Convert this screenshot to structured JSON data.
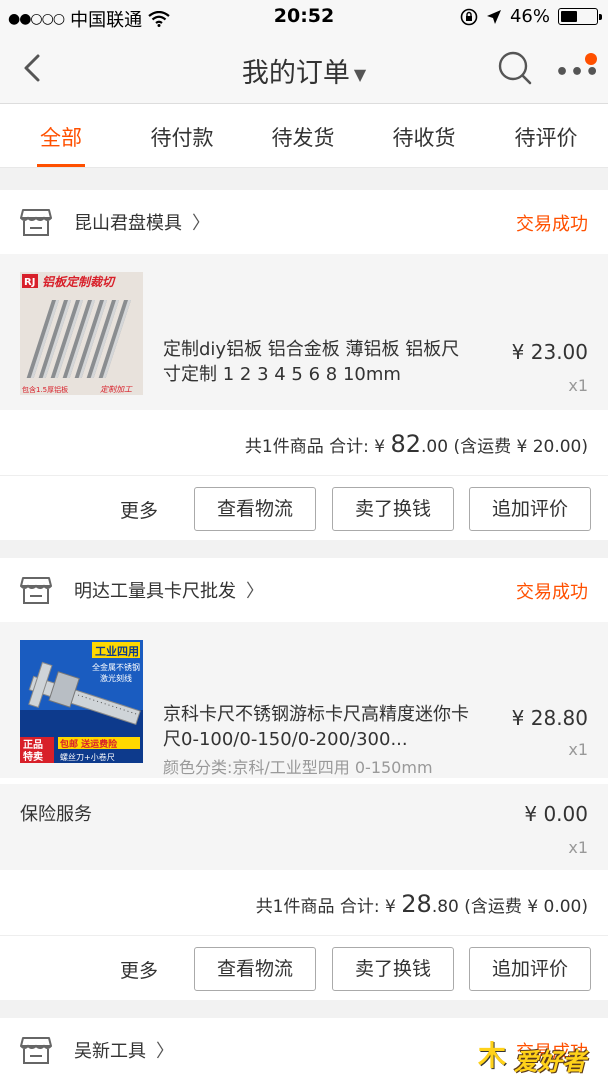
{
  "status_bar": {
    "carrier": "中国联通",
    "time": "20:52",
    "battery": "46%",
    "signal_dots": "●●○○○"
  },
  "nav": {
    "back_glyph": "〈",
    "title": "我的订单",
    "caret": "▼"
  },
  "tabs": [
    {
      "label": "全部",
      "active": true
    },
    {
      "label": "待付款"
    },
    {
      "label": "待发货"
    },
    {
      "label": "待收货"
    },
    {
      "label": "待评价"
    }
  ],
  "orders": [
    {
      "shop": "昆山君盘模具",
      "status": "交易成功",
      "item": {
        "title": "定制diy铝板 铝合金板 薄铝板 铝板尺寸定制 1 2 3 4 5 6 8 10mm",
        "price": "¥ 23.00",
        "qty": "x1",
        "thumb_text": "铝板定制裁切",
        "thumb_badge": "RJ",
        "thumb_note": "包含1.5厚铝板",
        "thumb_note2": "定制加工"
      },
      "summary": {
        "prefix": "共1件商品 合计: ¥ ",
        "big": "82",
        "small": ".00 (含运费 ¥ 20.00)"
      }
    },
    {
      "shop": "明达工量具卡尺批发",
      "status": "交易成功",
      "item": {
        "title": "京科卡尺不锈钢游标卡尺高精度迷你卡尺0-100/0-150/0-200/300...",
        "sub": "颜色分类:京科/工业型四用 0-150mm",
        "price": "¥ 28.80",
        "qty": "x1",
        "thumb_title": "工业四用",
        "thumb_line2": "全金属不锈钢",
        "thumb_line3": "激光刻线",
        "thumb_badge1": "正品",
        "thumb_badge2": "特卖",
        "thumb_gift": "包邮 送运费险",
        "thumb_gift2": "螺丝刀+小卷尺"
      },
      "insurance": {
        "label": "保险服务",
        "price": "¥ 0.00",
        "qty": "x1"
      },
      "summary": {
        "prefix": "共1件商品 合计: ¥ ",
        "big": "28",
        "small": ".80 (含运费 ¥ 0.00)"
      }
    },
    {
      "shop": "吴新工具",
      "status": "交易成功"
    }
  ],
  "actions": {
    "more": "更多",
    "logistics": "查看物流",
    "resell": "卖了换钱",
    "review": "追加评价"
  },
  "watermark": {
    "part1": "木",
    "part2": "爱好者"
  },
  "colors": {
    "accent": "#ff5000"
  }
}
